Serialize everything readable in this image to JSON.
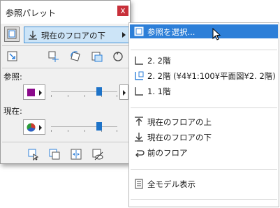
{
  "palette": {
    "title": "参照パレット",
    "close_label": "x",
    "dropdown_label": "現在のフロアの下",
    "reference_label": "参照:",
    "current_label": "現在:",
    "reference_level": 0.7,
    "current_level": 0.7
  },
  "menu": {
    "items": [
      {
        "label": "参照を選択...",
        "icon": "reference-icon",
        "highlighted": true
      },
      {
        "label": "2. 2階",
        "icon": "floor-icon"
      },
      {
        "label": "2. 2階 (¥4¥1:100¥平面図¥2. 2階)",
        "icon": "view-floor-icon"
      },
      {
        "label": "1. 1階",
        "icon": "floor-icon"
      },
      {
        "label": "現在のフロアの上",
        "icon": "arrow-up-icon"
      },
      {
        "label": "現在のフロアの下",
        "icon": "arrow-down-icon"
      },
      {
        "label": "前のフロア",
        "icon": "previous-icon"
      },
      {
        "label": "全モデル表示",
        "icon": "all-model-icon"
      }
    ]
  },
  "colors": {
    "accent": "#2d7fd8",
    "dropdown_bg": "#cce4f7",
    "close": "#c8303a",
    "ref_swatch": "#8b0a8b"
  }
}
